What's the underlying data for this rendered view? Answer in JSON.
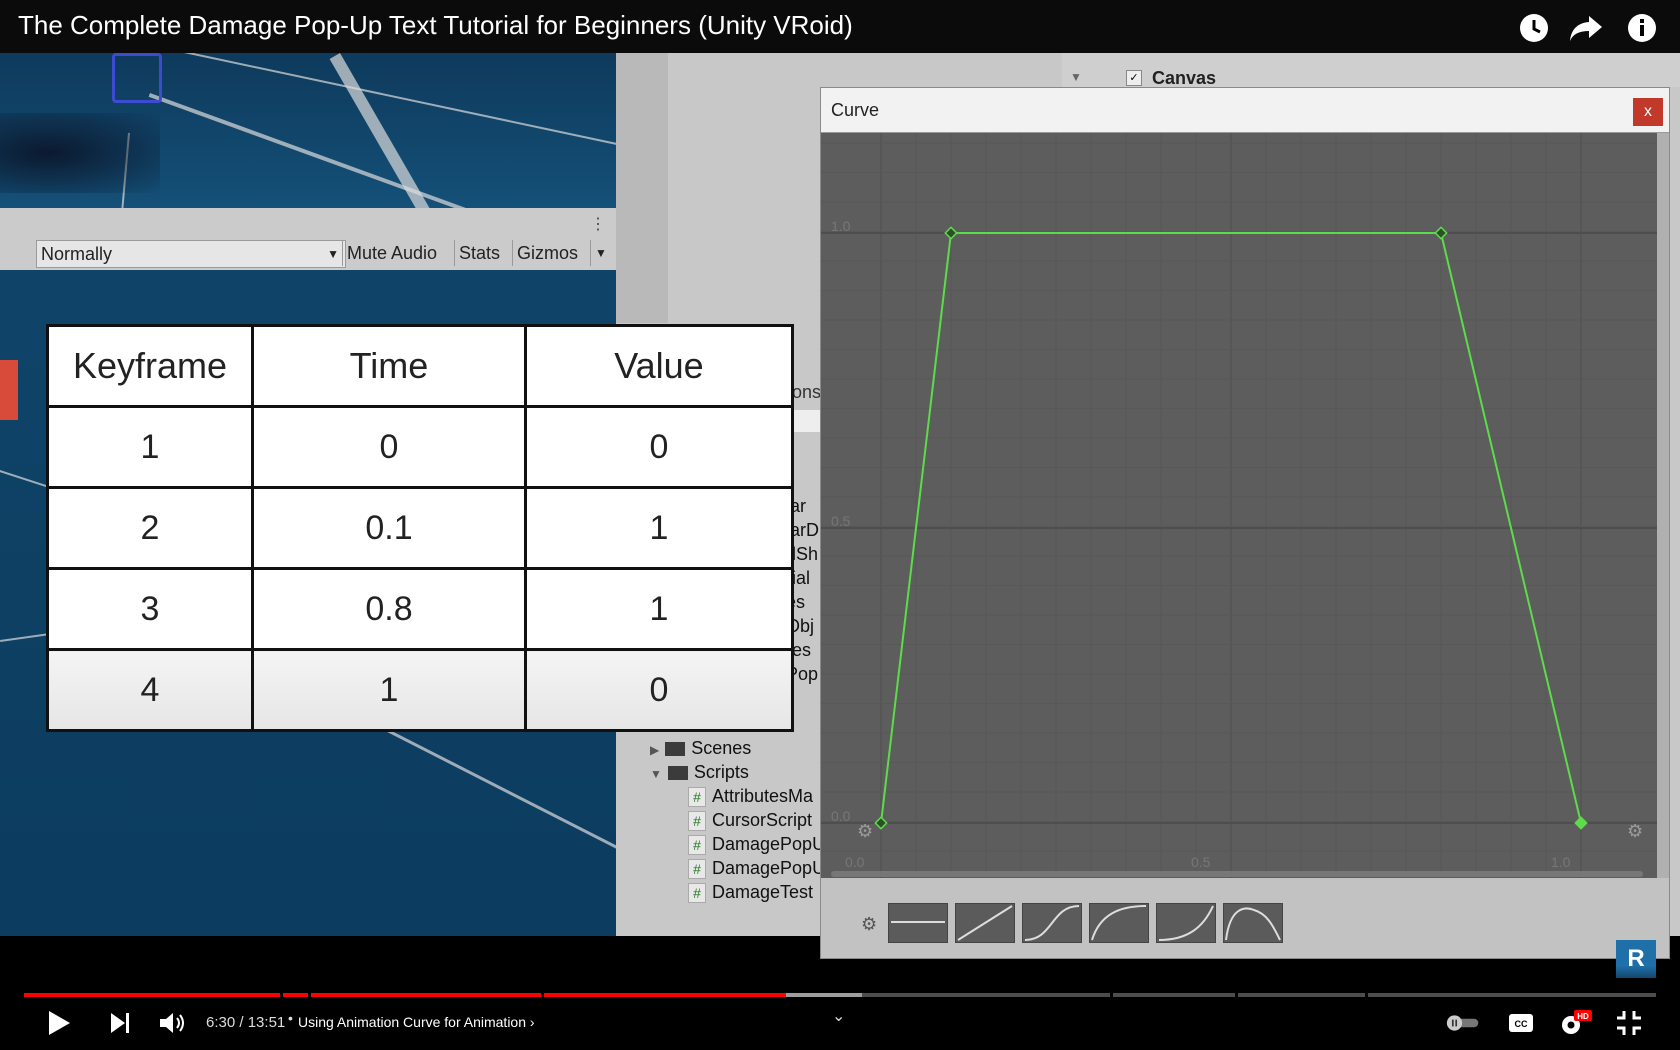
{
  "video": {
    "title": "The Complete Damage Pop-Up Text Tutorial for Beginners (Unity VRoid)",
    "time_current": "6:30",
    "time_separator": " / ",
    "time_total": "13:51",
    "chapter": "Using Animation Curve for Animation",
    "progress_fraction": 0.4687
  },
  "unity": {
    "hierarchy_canvas": "Canvas",
    "game_toolbar": {
      "mode": "Normally",
      "mute": "Mute Audio",
      "stats": "Stats",
      "gizmos": "Gizmos"
    },
    "project": {
      "partial_tab": "ons",
      "partial_items": [
        "ar",
        "arD",
        "dSh",
        "rial",
        "es",
        "Obj",
        "res",
        "Pop"
      ],
      "scenes": "Scenes",
      "scripts": "Scripts",
      "script_files": [
        "AttributesMa",
        "CursorScript",
        "DamagePopU",
        "DamagePopU",
        "DamageTest"
      ]
    }
  },
  "table": {
    "headers": [
      "Keyframe",
      "Time",
      "Value"
    ],
    "rows": [
      [
        "1",
        "0",
        "0"
      ],
      [
        "2",
        "0.1",
        "1"
      ],
      [
        "3",
        "0.8",
        "1"
      ],
      [
        "4",
        "1",
        "0"
      ]
    ]
  },
  "curve_window": {
    "title": "Curve",
    "close": "x",
    "y_labels": [
      "1.0",
      "0.5",
      "0.0"
    ],
    "x_labels": [
      "0.0",
      "0.5",
      "1.0"
    ],
    "curve_color": "#5cdc4a"
  },
  "chart_data": {
    "type": "line",
    "x": [
      0,
      0.1,
      0.8,
      1
    ],
    "series": [
      {
        "values": [
          0,
          1,
          1,
          0
        ]
      }
    ],
    "xlim": [
      0,
      1
    ],
    "ylim": [
      0,
      1
    ]
  },
  "colors": {
    "progress": "#ff0000",
    "close_button": "#c0392b"
  },
  "badge": "R"
}
